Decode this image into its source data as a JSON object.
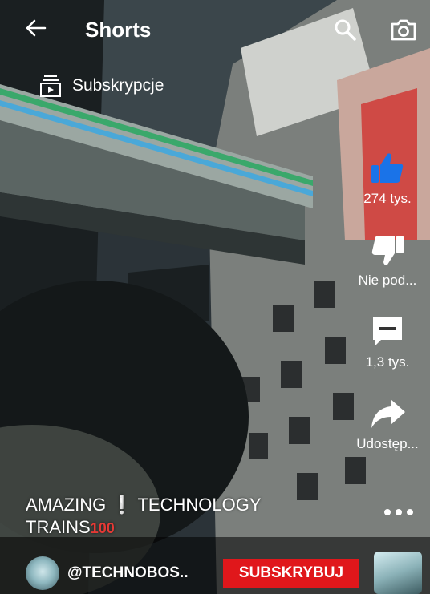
{
  "header": {
    "title": "Shorts"
  },
  "subscriptions": {
    "label": "Subskrypcje"
  },
  "actions": {
    "like": {
      "label": "274 tys."
    },
    "dislike": {
      "label": "Nie pod..."
    },
    "comments": {
      "label": "1,3 tys."
    },
    "share": {
      "label": "Udostęp..."
    }
  },
  "caption": {
    "part1": "AMAZING",
    "part2": "TECHNOLOGY",
    "part3": "TRAINS",
    "emoji": "100"
  },
  "channel": {
    "handle": "@TECHNOBOS..",
    "subscribe_label": "SUBSKRYBUJ"
  },
  "colors": {
    "like": "#1a73e8",
    "subscribe": "#e0171b"
  }
}
